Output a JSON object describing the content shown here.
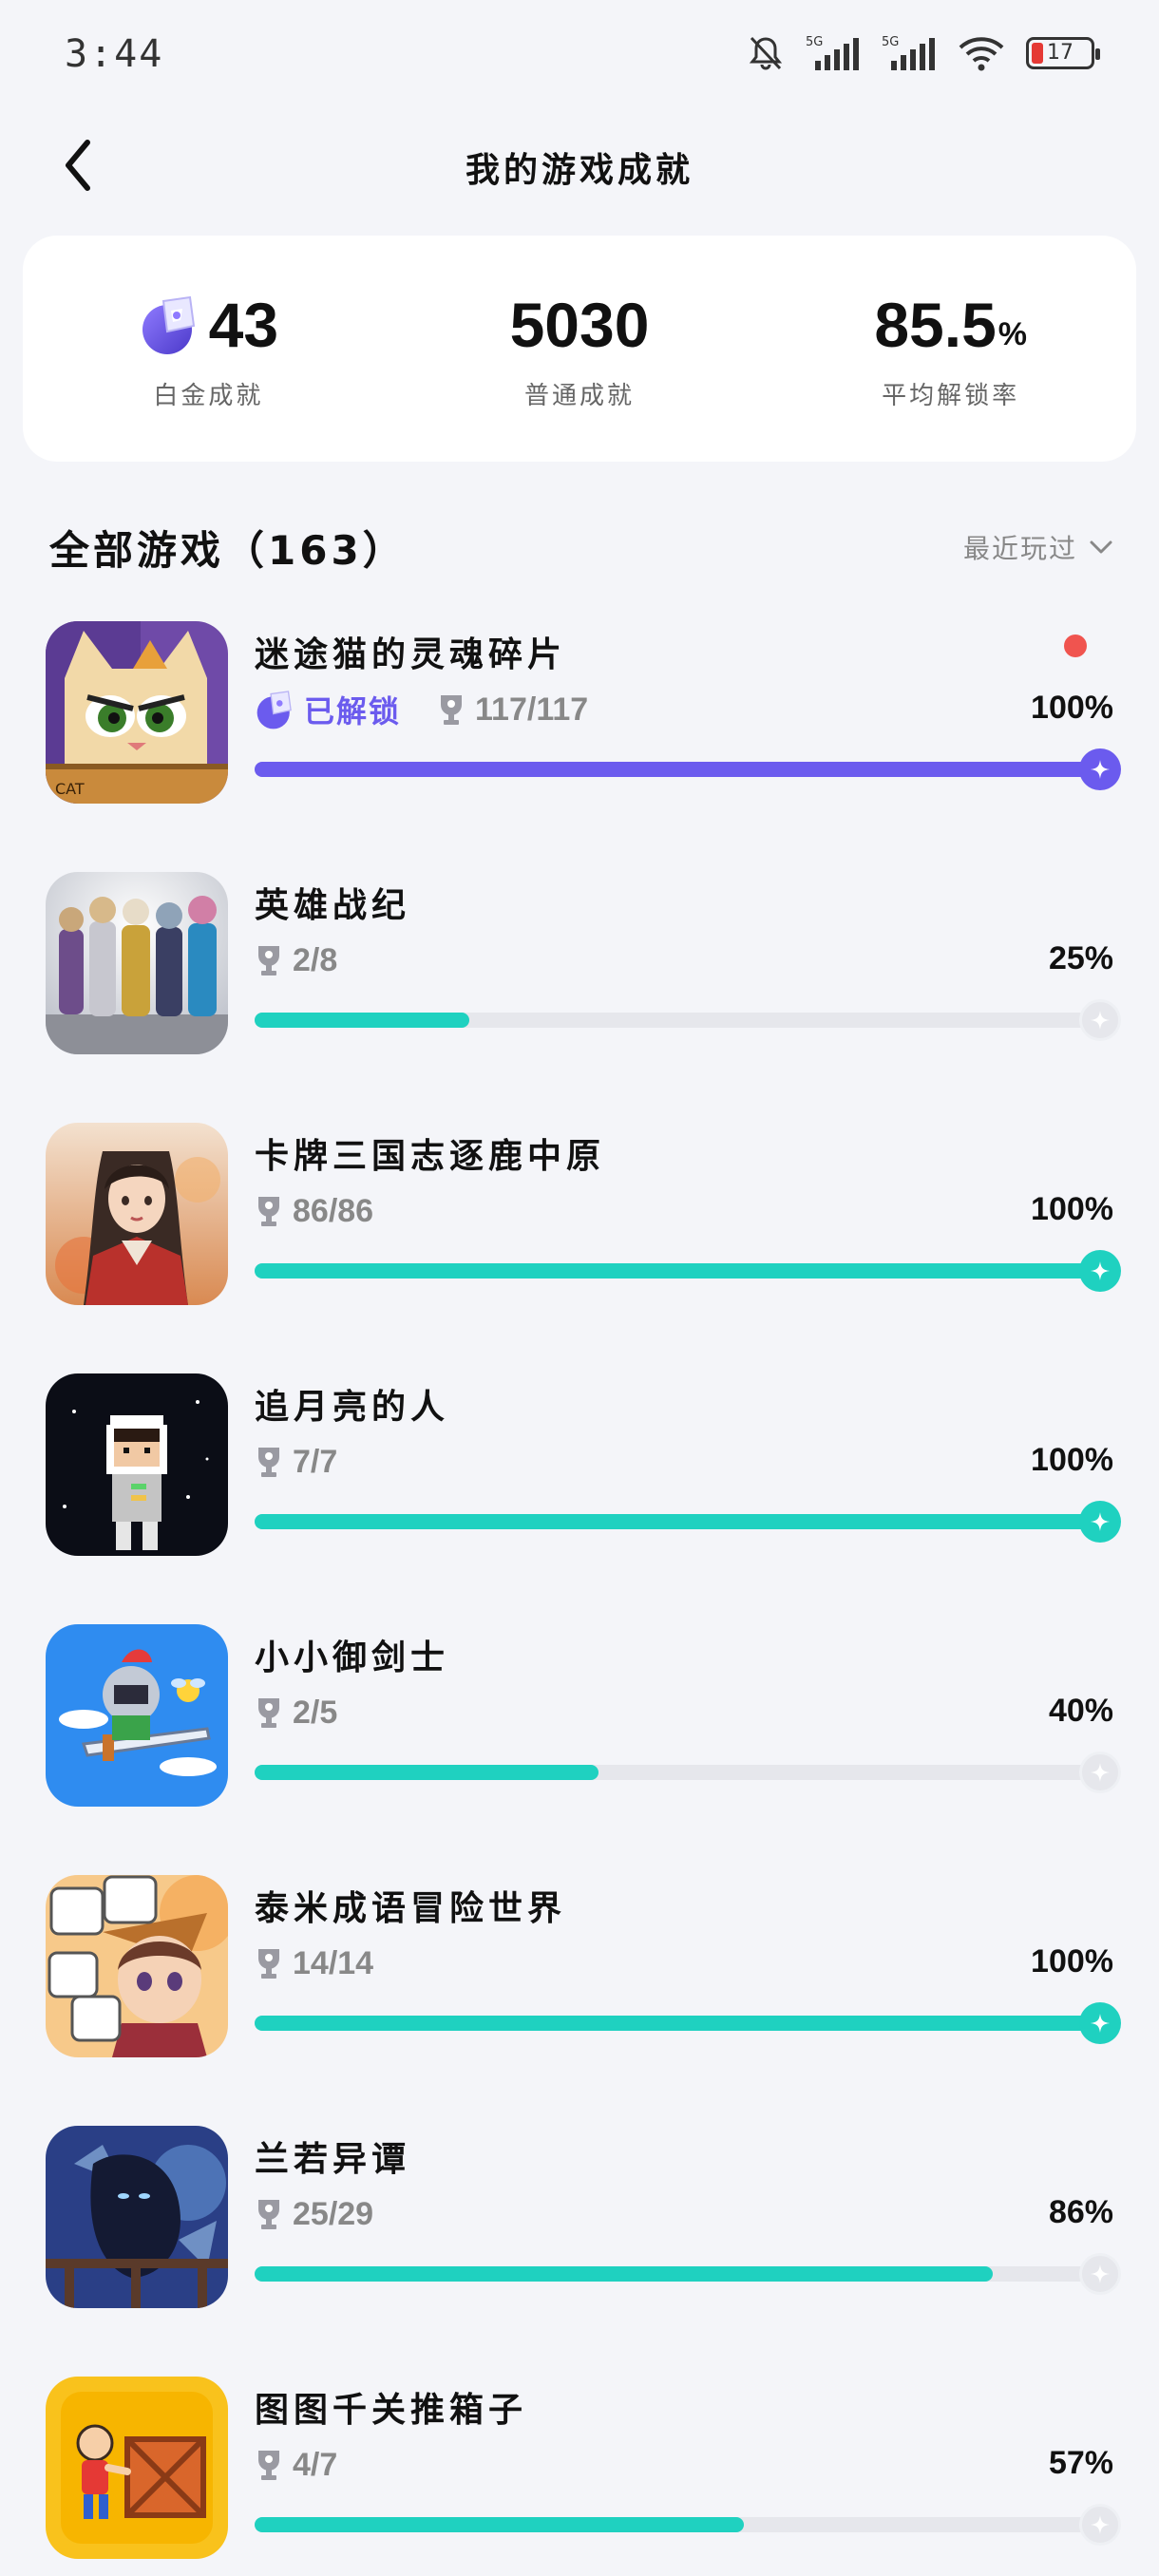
{
  "status_bar": {
    "time": "3:44",
    "battery": "17",
    "network": "5G"
  },
  "header": {
    "title": "我的游戏成就"
  },
  "summary": {
    "platinum": {
      "value": "43",
      "label": "白金成就"
    },
    "normal": {
      "value": "5030",
      "label": "普通成就"
    },
    "rate": {
      "value": "85.5",
      "suffix": "%",
      "label": "平均解锁率"
    }
  },
  "section": {
    "title": "全部游戏（163）",
    "sort_label": "最近玩过"
  },
  "colors": {
    "accent_purple": "#6b5bee",
    "accent_teal": "#1fd1c0",
    "track": "#e6e7ec",
    "dot_red": "#f0544f"
  },
  "games": [
    {
      "name": "迷途猫的灵魂碎片",
      "unlock_label": "已解锁",
      "count": "117/117",
      "percent": "100%",
      "progress": 1.0,
      "style": "platinum",
      "new": true,
      "icon": "cat-game-icon"
    },
    {
      "name": "英雄战纪",
      "count": "2/8",
      "percent": "25%",
      "progress": 0.25,
      "style": "normal",
      "new": false,
      "icon": "heroes-game-icon"
    },
    {
      "name": "卡牌三国志逐鹿中原",
      "count": "86/86",
      "percent": "100%",
      "progress": 1.0,
      "style": "normal",
      "new": false,
      "icon": "three-kingdoms-game-icon"
    },
    {
      "name": "追月亮的人",
      "count": "7/7",
      "percent": "100%",
      "progress": 1.0,
      "style": "normal",
      "new": false,
      "icon": "moon-chaser-game-icon"
    },
    {
      "name": "小小御剑士",
      "count": "2/5",
      "percent": "40%",
      "progress": 0.4,
      "style": "normal",
      "new": false,
      "icon": "sword-knight-game-icon"
    },
    {
      "name": "泰米成语冒险世界",
      "count": "14/14",
      "percent": "100%",
      "progress": 1.0,
      "style": "normal",
      "new": false,
      "icon": "idiom-adventure-game-icon"
    },
    {
      "name": "兰若异谭",
      "count": "25/29",
      "percent": "86%",
      "progress": 0.86,
      "style": "normal",
      "new": false,
      "icon": "lanruo-game-icon"
    },
    {
      "name": "图图千关推箱子",
      "count": "4/7",
      "percent": "57%",
      "progress": 0.57,
      "style": "normal",
      "new": false,
      "icon": "push-box-game-icon"
    }
  ]
}
